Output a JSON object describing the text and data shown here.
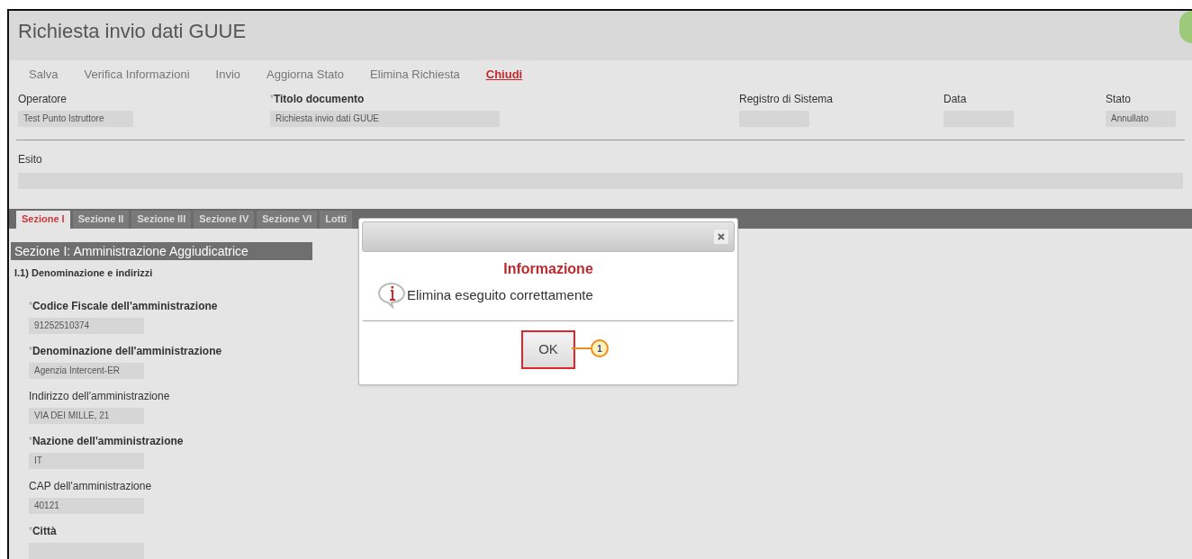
{
  "header": {
    "title": "Richiesta invio dati GUUE"
  },
  "toolbar": [
    {
      "label": "Salva",
      "highlighted": false
    },
    {
      "label": "Verifica Informazioni",
      "highlighted": false
    },
    {
      "label": "Invio",
      "highlighted": false
    },
    {
      "label": "Aggiorna Stato",
      "highlighted": false
    },
    {
      "label": "Elimina Richiesta",
      "highlighted": false
    },
    {
      "label": "Chiudi",
      "highlighted": true
    }
  ],
  "document_fields": [
    {
      "label": "Operatore",
      "required": false,
      "value": "Test Punto Istruttore"
    },
    {
      "label": "Titolo documento",
      "required": true,
      "value": "Richiesta invio dati GUUE"
    },
    {
      "label": "Registro di Sistema",
      "required": false
    },
    {
      "label": "Data",
      "required": false
    },
    {
      "label": "Stato",
      "required": false,
      "value": "Annullato"
    }
  ],
  "esito": {
    "label": "Esito"
  },
  "section_tabs": [
    {
      "label": "Sezione I",
      "selected": true
    },
    {
      "label": "Sezione II",
      "selected": false
    },
    {
      "label": "Sezione III",
      "selected": false
    },
    {
      "label": "Sezione IV",
      "selected": false
    },
    {
      "label": "Sezione VI",
      "selected": false
    },
    {
      "label": "Lotti",
      "selected": false
    }
  ],
  "section": {
    "title": "Sezione I: Amministrazione Aggiudicatrice",
    "subtitle": "I.1) Denominazione e indirizzi",
    "fields": [
      {
        "label": "Codice Fiscale dell'amministrazione",
        "required": true,
        "value": "91252510374"
      },
      {
        "label": "Denominazione dell'amministrazione",
        "required": true,
        "value": "Agenzia Intercent-ER"
      },
      {
        "label": "Indirizzo dell'amministrazione",
        "required": false,
        "value": "VIA DEI MILLE, 21"
      },
      {
        "label": "Nazione dell'amministrazione",
        "required": true,
        "value": "IT"
      },
      {
        "label": "CAP dell'amministrazione",
        "required": false,
        "value": "40121"
      },
      {
        "label": "Città",
        "required": true
      }
    ]
  },
  "dialog": {
    "title": "Informazione",
    "message": "Elimina eseguito correttamente",
    "button": "OK"
  },
  "callout": {
    "label": "1"
  },
  "required_mark": "*"
}
